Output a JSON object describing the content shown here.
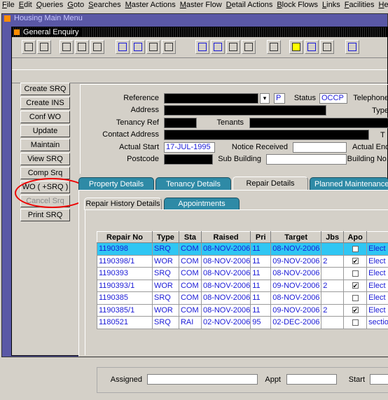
{
  "menu": [
    "File",
    "Edit",
    "Queries",
    "Goto",
    "Searches",
    "Master Actions",
    "Master Flow",
    "Detail Actions",
    "Block Flows",
    "Links",
    "Facilities",
    "He"
  ],
  "outer_window": {
    "title": "Housing Main Menu"
  },
  "inner_window": {
    "title": "General Enquiry"
  },
  "toolbar_icons": [
    "print-icon",
    "window-icon",
    "first-record-icon",
    "list-icon",
    "cancel-icon",
    "prev-icon",
    "next-icon",
    "search-icon",
    "clear-icon",
    "prev-block-icon",
    "next-block-icon",
    "insert-icon",
    "delete-icon",
    "edit-icon",
    "note-icon",
    "key-icon",
    "doc-icon",
    "help-icon"
  ],
  "actions": [
    {
      "label": "Create SRQ",
      "enabled": true
    },
    {
      "label": "Create INS",
      "enabled": true
    },
    {
      "label": "Conf WO",
      "enabled": true
    },
    {
      "label": "Update",
      "enabled": true
    },
    {
      "label": "Maintain",
      "enabled": true
    },
    {
      "label": "View SRQ",
      "enabled": true
    },
    {
      "label": "Comp Srq",
      "enabled": true
    },
    {
      "label": "WO ( +SRQ )",
      "enabled": true
    },
    {
      "label": "Cancel Srq",
      "enabled": false
    },
    {
      "label": "Print SRQ",
      "enabled": true
    }
  ],
  "form": {
    "reference_label": "Reference",
    "reference_value": "",
    "reference_suffix": "P",
    "status_label": "Status",
    "status_value": "OCCP",
    "telephone_label": "Telephone",
    "address_label": "Address",
    "type_label": "Type",
    "tenancy_ref_label": "Tenancy Ref",
    "tenants_label": "Tenants",
    "contact_address_label": "Contact Address",
    "contact_address_suffix": "T",
    "actual_start_label": "Actual Start",
    "actual_start_value": "17-JUL-1995",
    "notice_received_label": "Notice Received",
    "actual_end_label": "Actual End",
    "postcode_label": "Postcode",
    "sub_building_label": "Sub Building",
    "building_no_label": "Building No."
  },
  "tabs": [
    {
      "label": "Property Details",
      "active": false
    },
    {
      "label": "Tenancy Details",
      "active": false
    },
    {
      "label": "Repair Details",
      "active": true
    },
    {
      "label": "Planned Maintenance",
      "active": false
    }
  ],
  "subtabs": [
    {
      "label": "Repair History Details",
      "active": true
    },
    {
      "label": "Appointments",
      "active": false
    }
  ],
  "grid": {
    "columns": [
      "Repair No",
      "Type",
      "Sta",
      "Raised",
      "Pri",
      "Target",
      "Jbs",
      "Apo",
      ""
    ],
    "rows": [
      {
        "repair_no": "1190398",
        "type": "SRQ",
        "sta": "COM",
        "raised": "08-NOV-2006",
        "pri": "11",
        "target": "08-NOV-2006",
        "jbs": "",
        "apo": false,
        "desc": "Elect",
        "selected": true
      },
      {
        "repair_no": "1190398/1",
        "type": "WOR",
        "sta": "COM",
        "raised": "08-NOV-2006",
        "pri": "11",
        "target": "09-NOV-2006",
        "jbs": "2",
        "apo": true,
        "desc": "Elect",
        "selected": false
      },
      {
        "repair_no": "1190393",
        "type": "SRQ",
        "sta": "COM",
        "raised": "08-NOV-2006",
        "pri": "11",
        "target": "08-NOV-2006",
        "jbs": "",
        "apo": false,
        "desc": "Elect",
        "selected": false
      },
      {
        "repair_no": "1190393/1",
        "type": "WOR",
        "sta": "COM",
        "raised": "08-NOV-2006",
        "pri": "11",
        "target": "09-NOV-2006",
        "jbs": "2",
        "apo": true,
        "desc": "Elect",
        "selected": false
      },
      {
        "repair_no": "1190385",
        "type": "SRQ",
        "sta": "COM",
        "raised": "08-NOV-2006",
        "pri": "11",
        "target": "08-NOV-2006",
        "jbs": "",
        "apo": false,
        "desc": "Elect",
        "selected": false
      },
      {
        "repair_no": "1190385/1",
        "type": "WOR",
        "sta": "COM",
        "raised": "08-NOV-2006",
        "pri": "11",
        "target": "09-NOV-2006",
        "jbs": "2",
        "apo": true,
        "desc": "Elect",
        "selected": false
      },
      {
        "repair_no": "1180521",
        "type": "SRQ",
        "sta": "RAI",
        "raised": "02-NOV-2006",
        "pri": "95",
        "target": "02-DEC-2006",
        "jbs": "",
        "apo": false,
        "desc": "sectio",
        "selected": false
      }
    ]
  },
  "footer_fields": {
    "assigned_label": "Assigned",
    "appt_label": "Appt",
    "start_label": "Start"
  },
  "colors": {
    "outer_title_bg": "#5a58a6",
    "tab_bg": "#2e8aa6",
    "selected_row": "#2fc6f3",
    "value_text": "#1a1ad6",
    "annotation_circle": "#e00000"
  }
}
